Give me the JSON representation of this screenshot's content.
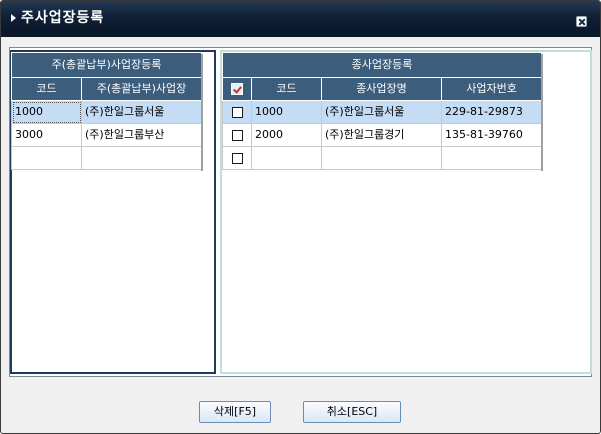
{
  "window": {
    "title": "주사업장등록"
  },
  "left_panel": {
    "group_header": "주(총괄납부)사업장등록",
    "columns": [
      "코드",
      "주(총괄납부)사업장"
    ],
    "rows": [
      [
        "1000",
        "(주)한일그룹서울"
      ],
      [
        "3000",
        "(주)한일그룹부산"
      ]
    ]
  },
  "right_panel": {
    "group_header": "종사업장등록",
    "columns": [
      "코드",
      "종사업장명",
      "사업자번호"
    ],
    "rows": [
      [
        "1000",
        "(주)한일그룹서울",
        "229-81-29873"
      ],
      [
        "2000",
        "(주)한일그룹경기",
        "135-81-39760"
      ]
    ]
  },
  "buttons": {
    "delete": "삭제[F5]",
    "cancel": "취소[ESC]"
  },
  "colors": {
    "header_bg": "#3c5d7c",
    "selected_row": "#c5dcf5",
    "title_bg": "#0f1f35"
  }
}
